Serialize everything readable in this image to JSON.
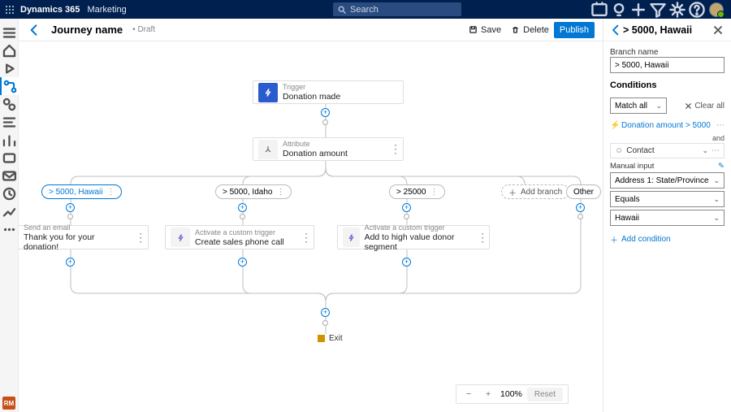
{
  "brand": {
    "name": "Dynamics 365",
    "module": "Marketing",
    "search_placeholder": "Search"
  },
  "topbar": {
    "title": "Journey name",
    "status": "Draft",
    "save": "Save",
    "delete": "Delete",
    "publish": "Publish"
  },
  "nodes": {
    "trigger": {
      "kicker": "Trigger",
      "title": "Donation made"
    },
    "attribute": {
      "kicker": "Attribute",
      "title": "Donation amount"
    },
    "branch1_email": {
      "kicker": "Send an email",
      "title": "Thank you for your donation!"
    },
    "branch2_trig": {
      "kicker": "Activate a custom trigger",
      "title": "Create sales phone call"
    },
    "branch3_trig": {
      "kicker": "Activate a custom trigger",
      "title": "Add to high value donor segment"
    }
  },
  "branches": {
    "b1": "> 5000, Hawaii",
    "b2": "> 5000, Idaho",
    "b3": "> 25000",
    "add": "Add branch",
    "other": "Other"
  },
  "exit": "Exit",
  "zoom": {
    "level": "100%",
    "reset": "Reset"
  },
  "panel": {
    "title": "> 5000, Hawaii",
    "branch_name_label": "Branch name",
    "branch_name_value": "> 5000, Hawaii",
    "conditions_label": "Conditions",
    "match": "Match all",
    "clear_all": "Clear all",
    "cond1": "Donation amount > 5000",
    "and": "and",
    "contact": "Contact",
    "manual_input": "Manual input",
    "field": "Address 1: State/Province",
    "operator": "Equals",
    "value": "Hawaii",
    "add_condition": "Add condition"
  },
  "rm": "RM"
}
